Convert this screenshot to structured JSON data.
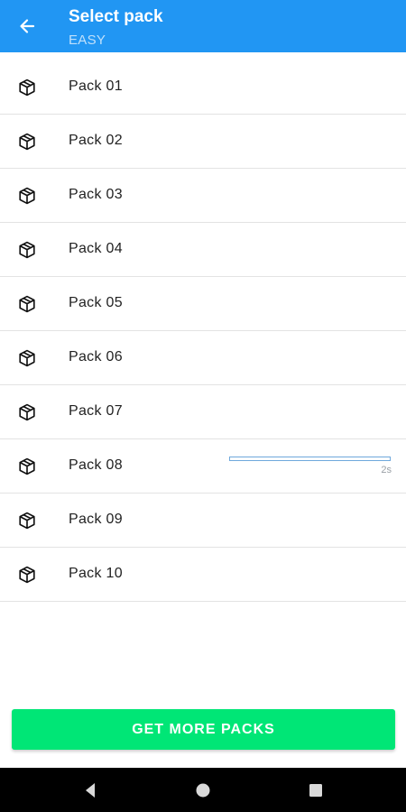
{
  "header": {
    "title": "Select pack",
    "subtitle": "EASY"
  },
  "packs": [
    {
      "label": "Pack 01"
    },
    {
      "label": "Pack 02"
    },
    {
      "label": "Pack 03"
    },
    {
      "label": "Pack 04"
    },
    {
      "label": "Pack 05"
    },
    {
      "label": "Pack 06"
    },
    {
      "label": "Pack 07"
    },
    {
      "label": "Pack 08",
      "progress": 0,
      "time": "2s"
    },
    {
      "label": "Pack 09"
    },
    {
      "label": "Pack 10"
    }
  ],
  "cta": {
    "label": "GET MORE PACKS"
  },
  "colors": {
    "appbar": "#2196f3",
    "cta": "#00e676",
    "progress": "#6fa8dc"
  },
  "icons": {
    "back": "arrow-left-icon",
    "pack": "cube-icon"
  }
}
